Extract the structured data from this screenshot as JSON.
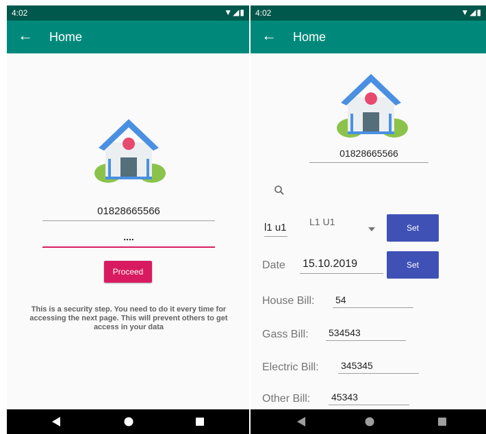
{
  "left_screen": {
    "status_time": "4:02",
    "status_icons": "▼◢▮",
    "title": "Home",
    "phone_value": "01828665566",
    "password_value": "....",
    "proceed_label": "Proceed",
    "security_message": "This is a security step. You need to do it every time for accessing the next page. This will prevent others to get access in your data"
  },
  "right_screen": {
    "status_time": "4:02",
    "status_icons": "▼◢▮",
    "title": "Home",
    "phone_value": "01828665566",
    "unit_input": "l1 u1",
    "unit_select": "L1 U1",
    "set_label_1": "Set",
    "date_label": "Date",
    "date_value": "15.10.2019",
    "set_label_2": "Set",
    "house_bill_label": "House Bill:",
    "house_bill_value": "54",
    "gass_bill_label": "Gass Bill:",
    "gass_bill_value": "534543",
    "electric_bill_label": "Electric Bill:",
    "electric_bill_value": "345345",
    "other_bill_label": "Other Bill:",
    "other_bill_value": "45343"
  },
  "colors": {
    "status_bar": "#00574b",
    "app_bar": "#00897b",
    "accent_pink": "#d81b60",
    "set_button": "#3f51b5"
  },
  "icons": [
    "back-arrow-icon",
    "house-icon",
    "search-icon",
    "dropdown-arrow-icon",
    "nav-back-icon",
    "nav-home-icon",
    "nav-recents-icon"
  ]
}
